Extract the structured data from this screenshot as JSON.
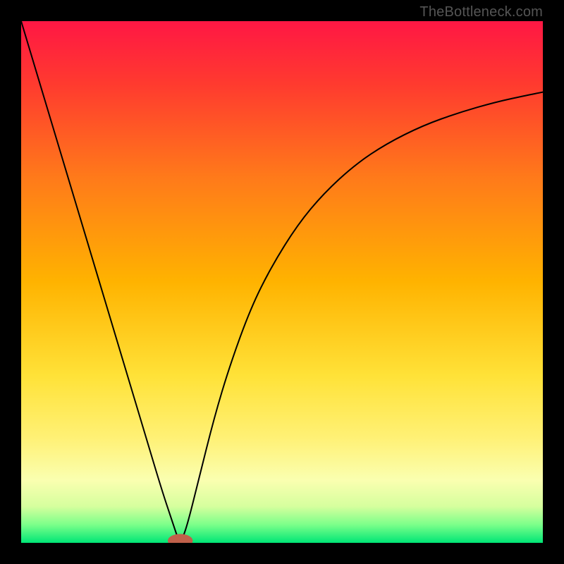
{
  "credit": "TheBottleneck.com",
  "chart_data": {
    "type": "line",
    "title": "",
    "xlabel": "",
    "ylabel": "",
    "xlim": [
      0,
      100
    ],
    "ylim": [
      0,
      100
    ],
    "grid": false,
    "legend": false,
    "background_gradient": {
      "stops": [
        {
          "offset": 0.0,
          "color": "#ff1744"
        },
        {
          "offset": 0.12,
          "color": "#ff3a2f"
        },
        {
          "offset": 0.3,
          "color": "#ff7a1a"
        },
        {
          "offset": 0.5,
          "color": "#ffb300"
        },
        {
          "offset": 0.68,
          "color": "#ffe238"
        },
        {
          "offset": 0.8,
          "color": "#fff176"
        },
        {
          "offset": 0.88,
          "color": "#faffb0"
        },
        {
          "offset": 0.93,
          "color": "#d6ff9e"
        },
        {
          "offset": 0.965,
          "color": "#7cff8a"
        },
        {
          "offset": 1.0,
          "color": "#00e676"
        }
      ]
    },
    "minimum_marker": {
      "x": 30.5,
      "y": 0,
      "color": "#c0604a",
      "rx": 2.4,
      "ry": 1.3
    },
    "series": [
      {
        "name": "curve",
        "color": "#000000",
        "width": 2,
        "x": [
          0,
          3,
          6,
          9,
          12,
          15,
          18,
          21,
          24,
          27,
          29,
          30,
          30.5,
          31,
          32,
          34,
          37,
          40,
          44,
          48,
          53,
          58,
          64,
          70,
          77,
          84,
          91,
          97,
          100
        ],
        "values": [
          100,
          90,
          80,
          70,
          60,
          50,
          40,
          30,
          20,
          10,
          4,
          1,
          0,
          1,
          4,
          12,
          24,
          34,
          45,
          53,
          61,
          67,
          72.5,
          76.5,
          80,
          82.5,
          84.5,
          85.8,
          86.4
        ]
      }
    ]
  }
}
